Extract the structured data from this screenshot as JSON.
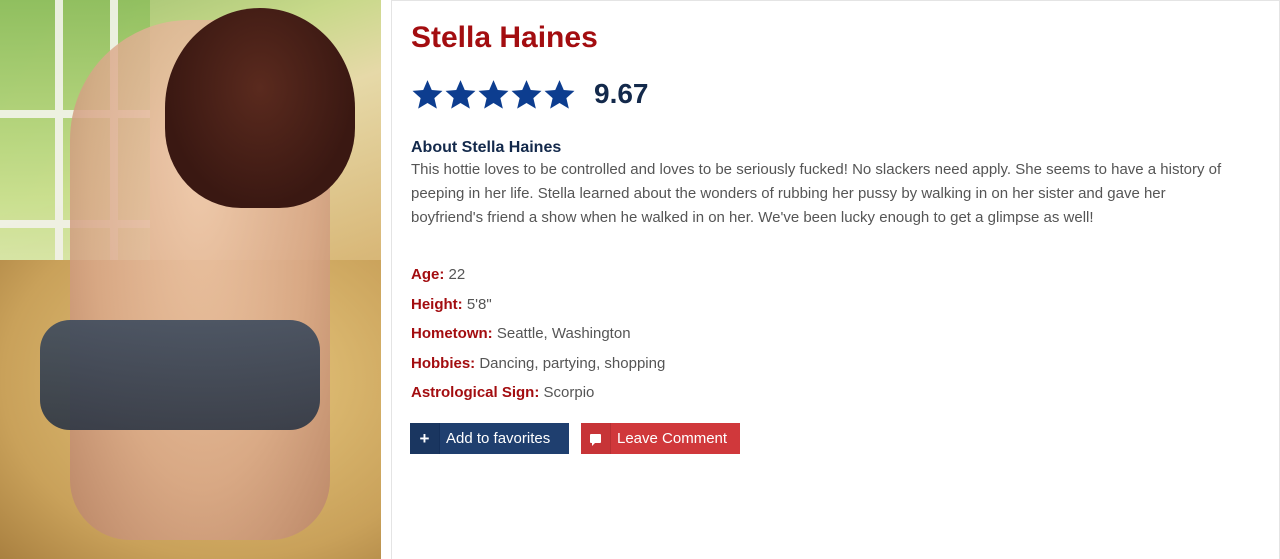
{
  "model": {
    "name": "Stella Haines",
    "rating": {
      "stars": 5,
      "score": "9.67",
      "star_color": "#0d3d8f"
    },
    "about_title": "About Stella Haines",
    "about_text": "This hottie loves to be controlled and loves to be seriously fucked! No slackers need apply. She seems to have a history of peeping in her life. Stella learned about the wonders of rubbing her pussy by walking in on her sister and gave her boyfriend's friend a show when he walked in on her. We've been lucky enough to get a glimpse as well!",
    "facts": [
      {
        "label": "Age:",
        "value": "22"
      },
      {
        "label": "Height:",
        "value": "5'8\""
      },
      {
        "label": "Hometown:",
        "value": "Seattle, Washington"
      },
      {
        "label": "Hobbies:",
        "value": "Dancing, partying, shopping"
      },
      {
        "label": "Astrological Sign:",
        "value": "Scorpio"
      }
    ]
  },
  "actions": {
    "favorites": {
      "icon": "plus-icon",
      "icon_glyph": "+",
      "label": "Add to favorites"
    },
    "comment": {
      "icon": "comment-icon",
      "label": "Leave Comment"
    }
  },
  "colors": {
    "accent_red": "#a30d10",
    "navy": "#13294b",
    "button_blue": "#1f3f6f",
    "button_red": "#d0383b"
  }
}
